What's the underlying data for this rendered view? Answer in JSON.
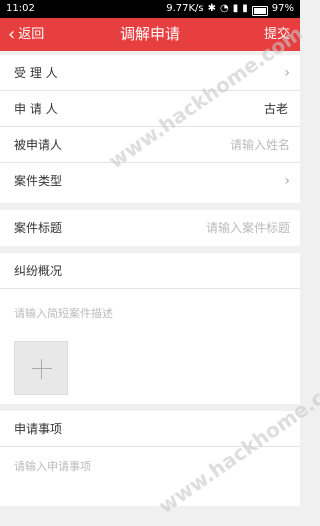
{
  "status_bar": {
    "time": "11:02",
    "network_speed": "9.77K/s",
    "battery": "97%"
  },
  "nav": {
    "back_label": "返回",
    "title": "调解申请",
    "submit_label": "提交"
  },
  "form": {
    "acceptor_label": "受 理 人",
    "applicant_label": "申 请 人",
    "applicant_value": "古老",
    "respondent_label": "被申请人",
    "respondent_placeholder": "请输入姓名",
    "case_type_label": "案件类型",
    "case_title_label": "案件标题",
    "case_title_placeholder": "请输入案件标题",
    "dispute_label": "纠纷概况",
    "dispute_placeholder": "请输入简短案件描述",
    "request_label": "申请事项",
    "request_placeholder": "请输入申请事项"
  },
  "watermark": "www.hackhome.com"
}
